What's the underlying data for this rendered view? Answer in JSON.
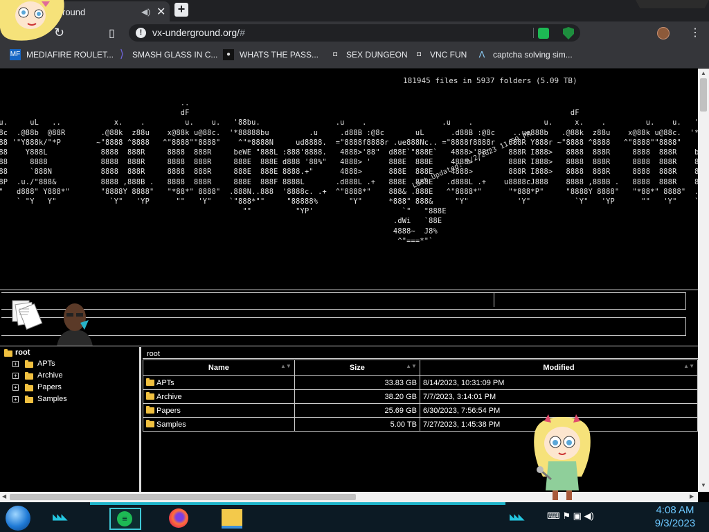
{
  "browser": {
    "tab": {
      "title": "round",
      "audio_icon": "speaker-icon",
      "close_symbol": "✕"
    },
    "new_tab_symbol": "+",
    "address": {
      "url": "vx-underground.org/",
      "hash": "#"
    },
    "menu_symbol": "⋮",
    "bookmarks": [
      {
        "icon": "mediafire-icon",
        "icon_text": "MF",
        "label": "MEDIAFIRE ROULET..."
      },
      {
        "icon": "visual-studio-icon",
        "icon_text": "⟩",
        "label": "SMASH GLASS IN C..."
      },
      {
        "icon": "ghost-icon",
        "icon_text": "●",
        "label": "WHATS THE PASS..."
      },
      {
        "icon": "trash-icon",
        "icon_text": "◘",
        "label": "SEX DUNGEON"
      },
      {
        "icon": "vnc-icon",
        "icon_text": "◘",
        "label": "VNC FUN"
      },
      {
        "icon": "lambda-icon",
        "icon_text": "Λ",
        "label": "captcha solving sim..."
      }
    ]
  },
  "page": {
    "stats": "181945 files in 5937 folders (5.09 TB)",
    "updated_banner": "Last Updated: 9/2/2023 11:59 PM",
    "ascii_art": "                                          ..\n                                          dF                                                                                      dF\n u.     uL   ..            x.    .         u.    u.   '88bu.                 .u    .                 .u    .                u.     x.    .         u.    u.   '88\n88c  .@88b  @88R        .@88k  z88u    x@88k u@88c.  '*88888bu         .u     .d88B :@8c       uL      .d88B :@8c    ..ue888b   .@88k  z88u    x@88k u@88c.  '*8\n888 '\"Y888k/\"*P        ~\"8888 ^8888   ^\"8888\"\"8888\"    ^\"*8888N     ud8888.  =\"8888f8888r .ue888Nc.. =\"8888f8888r   888R Y888r ~\"8888 ^8888   ^\"8888\"\"8888\"    ^\n888    Y888L            8888  888R     8888  888R     beWE \"888L :888'8888.   4888>'88\"  d88E`\"888E`   4888>'88\"    888R I888>   8888  888R     8888  888R    be\n888     8888            8888  888R     8888  888R     888E  888E d888 '88%\"   4888> '    888E  888E    4888> '      888R I888>   8888  888R     8888  888R    88\n888     `888N           8888  888R     8888  888R     888E  888E 8888.+\"      4888>      888E  888E    4888>        888R I888>   8888  888R     8888  888R    88\n88P  .u./\"888&          8888 ,888B .   8888  888R     888E  888F 8888L       .d888L .+   888E  888E   .d888L .+    u8888cJ888    8888 ,888B .   8888  888R    88\n*\"   d888\" Y888*\"       \"8888Y 8888\"   \"*88*\" 8888\"  .888N..888  '8888c. .+  ^\"8888*\"    888& .888E   ^\"8888*\"      \"*888*P\"     \"8888Y 8888\"   \"*88*\" 8888\"  .8\n`    ` \"Y   Y\"            `Y\"   'YP      \"\"   'Y\"    `\"888*\"\"     \"88888%       \"Y\"      *888\" 888&     \"Y\"           'Y\"          `Y\"   'YP      \"\"   'Y\"    `\"\n                                                        \"\"          \"YP'                    `\"   \"888E\n                                                                                          .dWi   `88E\n                                                                                          4888~  J8%\n                                                                                           ^\"===*\"`",
    "tree": {
      "root": "root",
      "items": [
        "APTs",
        "Archive",
        "Papers",
        "Samples"
      ],
      "expander_symbol": "+"
    },
    "listing": {
      "path": "root",
      "columns": [
        "Name",
        "Size",
        "Modified"
      ],
      "sort_symbol": "▲▼",
      "rows": [
        {
          "name": "APTs",
          "size": "33.83 GB",
          "modified": "8/14/2023, 10:31:09 PM"
        },
        {
          "name": "Archive",
          "size": "38.20 GB",
          "modified": "7/7/2023, 3:14:01 PM"
        },
        {
          "name": "Papers",
          "size": "25.69 GB",
          "modified": "6/30/2023, 7:56:54 PM"
        },
        {
          "name": "Samples",
          "size": "5.00 TB",
          "modified": "7/27/2023, 1:45:38 PM"
        }
      ]
    }
  },
  "taskbar": {
    "chevrons": "◣◣◣",
    "tray_icons": [
      "keyboard-icon",
      "flag-icon",
      "network-icon",
      "volume-icon"
    ],
    "tray_text": "⌨  ⚑  ▣  ◀)",
    "time": "4:08 AM",
    "date": "9/3/2023"
  },
  "colors": {
    "accent": "#1fb3c9",
    "folder": "#f0c040",
    "page_bg": "#000000"
  }
}
